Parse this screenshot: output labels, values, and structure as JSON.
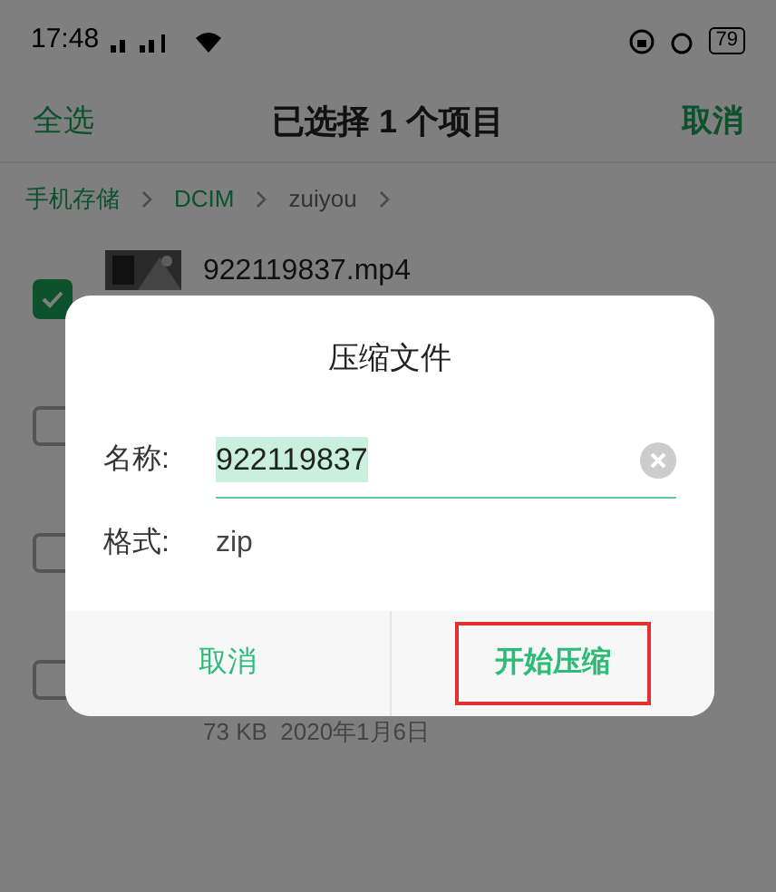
{
  "status_bar": {
    "time": "17:48",
    "battery": "79"
  },
  "header": {
    "left": "全选",
    "title": "已选择 1 个项目",
    "right": "取消"
  },
  "breadcrumb": [
    "手机存储",
    "DCIM",
    "zuiyou"
  ],
  "files": [
    {
      "name": "922119837.mp4",
      "checked": true
    },
    {
      "checked": false
    },
    {
      "checked": false
    },
    {
      "meta": "73 KB  2020年1月6日",
      "checked": false
    }
  ],
  "dialog": {
    "title": "压缩文件",
    "name_label": "名称:",
    "name_value": "922119837",
    "format_label": "格式:",
    "format_value": "zip",
    "buttons": [
      {
        "label": "取消",
        "highlighted": false
      },
      {
        "label": "开始压缩",
        "highlighted": true
      }
    ]
  }
}
